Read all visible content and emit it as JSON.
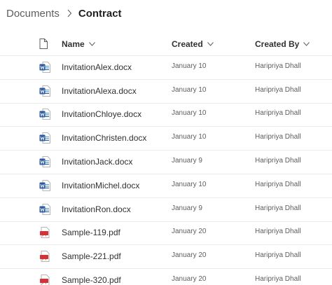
{
  "breadcrumb": {
    "root": "Documents",
    "current": "Contract"
  },
  "header": {
    "name": "Name",
    "created": "Created",
    "created_by": "Created By"
  },
  "colors": {
    "word": "#2b579a",
    "pdf": "#d13438",
    "divider": "#edebe9"
  },
  "files": [
    {
      "name": "InvitationAlex.docx",
      "created": "January 10",
      "created_by": "Haripriya Dhall",
      "icon": "word-doc-icon"
    },
    {
      "name": "InvitationAlexa.docx",
      "created": "January 10",
      "created_by": "Haripriya Dhall",
      "icon": "word-doc-icon"
    },
    {
      "name": "InvitationChloye.docx",
      "created": "January 10",
      "created_by": "Haripriya Dhall",
      "icon": "word-doc-icon"
    },
    {
      "name": "InvitationChristen.docx",
      "created": "January 10",
      "created_by": "Haripriya Dhall",
      "icon": "word-doc-icon"
    },
    {
      "name": "InvitationJack.docx",
      "created": "January 9",
      "created_by": "Haripriya Dhall",
      "icon": "word-doc-icon"
    },
    {
      "name": "InvitationMichel.docx",
      "created": "January 10",
      "created_by": "Haripriya Dhall",
      "icon": "word-doc-icon"
    },
    {
      "name": "InvitationRon.docx",
      "created": "January 9",
      "created_by": "Haripriya Dhall",
      "icon": "word-doc-icon"
    },
    {
      "name": "Sample-119.pdf",
      "created": "January 20",
      "created_by": "Haripriya Dhall",
      "icon": "pdf-icon"
    },
    {
      "name": "Sample-221.pdf",
      "created": "January 20",
      "created_by": "Haripriya Dhall",
      "icon": "pdf-icon"
    },
    {
      "name": "Sample-320.pdf",
      "created": "January 20",
      "created_by": "Haripriya Dhall",
      "icon": "pdf-icon"
    }
  ]
}
